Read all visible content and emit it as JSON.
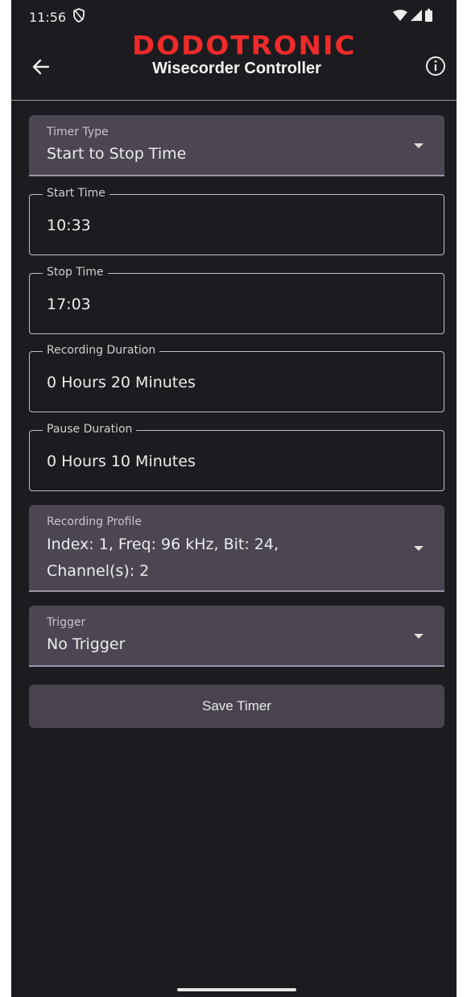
{
  "status_bar": {
    "time": "11:56"
  },
  "app_bar": {
    "logo_text": "DODOTRONIC",
    "title": "Wisecorder Controller"
  },
  "form": {
    "timer_type": {
      "label": "Timer Type",
      "value": "Start to Stop Time"
    },
    "start_time": {
      "label": "Start Time",
      "value": "10:33"
    },
    "stop_time": {
      "label": "Stop Time",
      "value": "17:03"
    },
    "recording_duration": {
      "label": "Recording Duration",
      "value": "0 Hours 20 Minutes"
    },
    "pause_duration": {
      "label": "Pause Duration",
      "value": "0 Hours 10 Minutes"
    },
    "recording_profile": {
      "label": "Recording Profile",
      "value_line1": "Index: 1, Freq: 96 kHz, Bit: 24,",
      "value_line2": "Channel(s): 2"
    },
    "trigger": {
      "label": "Trigger",
      "value": "No Trigger"
    }
  },
  "save_button": {
    "label": "Save Timer"
  },
  "colors": {
    "background": "#1c1b1f",
    "field_fill": "#4b4651",
    "logo_red": "#ef2b2b",
    "underline": "#9d93a9"
  }
}
